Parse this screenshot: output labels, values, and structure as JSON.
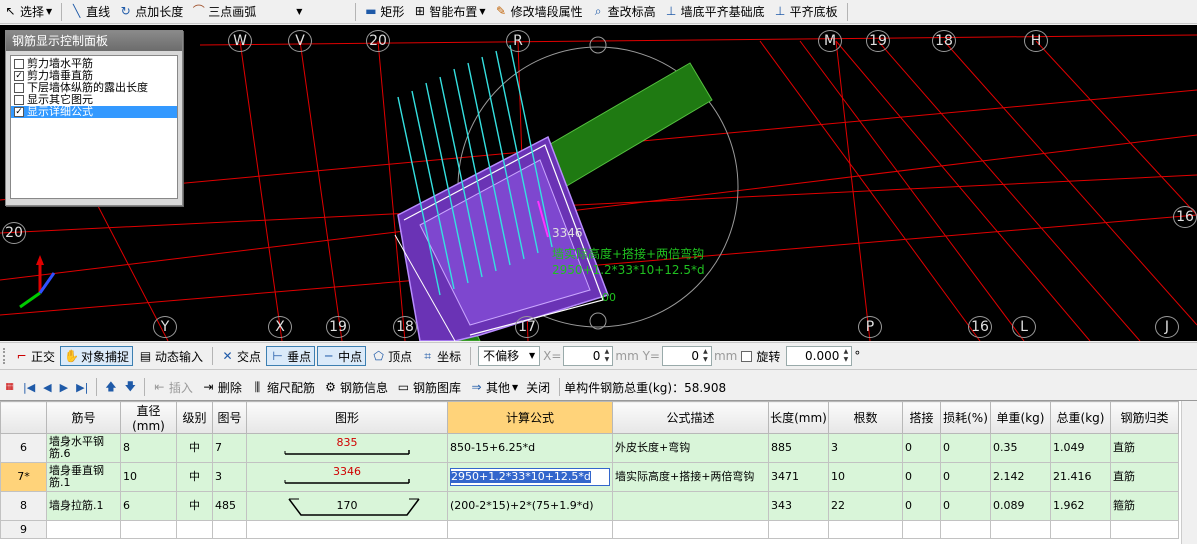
{
  "toolbar_main": [
    {
      "id": "select",
      "label": "选择",
      "icon": "cursor-icon",
      "dropdown": true
    },
    {
      "id": "line",
      "label": "直线",
      "icon": "line-icon"
    },
    {
      "id": "point-length",
      "label": "点加长度",
      "icon": "point-length-icon"
    },
    {
      "id": "arc3",
      "label": "三点画弧",
      "icon": "arc-icon",
      "dropdown": true
    },
    {
      "id": "rect",
      "label": "矩形",
      "icon": "rectangle-icon"
    },
    {
      "id": "smart",
      "label": "智能布置",
      "icon": "smart-layout-icon",
      "dropdown": true
    },
    {
      "id": "modify-wall",
      "label": "修改墙段属性",
      "icon": "edit-wall-icon"
    },
    {
      "id": "check-elev",
      "label": "查改标高",
      "icon": "elevation-icon"
    },
    {
      "id": "align-base",
      "label": "墙底平齐基础底",
      "icon": "wall-align-icon"
    },
    {
      "id": "align-bottom",
      "label": "平齐底板",
      "icon": "slab-align-icon"
    }
  ],
  "panel": {
    "title": "钢筋显示控制面板",
    "items": [
      {
        "label": "剪力墙水平筋",
        "checked": false,
        "selected": false
      },
      {
        "label": "剪力墙垂直筋",
        "checked": true,
        "selected": false
      },
      {
        "label": "下层墙体纵筋的露出长度",
        "checked": false,
        "selected": false
      },
      {
        "label": "显示其它图元",
        "checked": false,
        "selected": false
      },
      {
        "label": "显示详细公式",
        "checked": true,
        "selected": true
      }
    ]
  },
  "canvas": {
    "axis_labels": [
      "W",
      "V",
      "20",
      "R",
      "M",
      "19",
      "18",
      "H",
      "20",
      "16",
      "Y",
      "X",
      "19",
      "18",
      "17",
      "P",
      "16",
      "L",
      "J"
    ],
    "annotation_length": "3346",
    "annotation_desc": "墙实际高度+搭接+两倍弯钩",
    "annotation_formula": "2950+1.2*33*10+12.5*d",
    "annotation_extra": "00"
  },
  "toolbar_snap": {
    "ortho": "正交",
    "snap": "对象捕捉",
    "dyn": "动态输入",
    "intersect": "交点",
    "perp": "垂点",
    "mid": "中点",
    "vertex": "顶点",
    "coord": "坐标",
    "offset": "不偏移",
    "x_label": "X=",
    "x_value": "0",
    "y_label": "mm Y=",
    "y_value": "0",
    "unit": "mm",
    "rotate": "旋转",
    "rotate_value": "0.000",
    "degree": "°"
  },
  "toolbar_grid": {
    "insert": "插入",
    "delete": "删除",
    "scale": "缩尺配筋",
    "rebar_info": "钢筋信息",
    "rebar_lib": "钢筋图库",
    "other": "其他",
    "close": "关闭",
    "total_label": "单构件钢筋总重(kg)：58.908"
  },
  "table": {
    "columns": [
      "",
      "筋号",
      "直径(mm)",
      "级别",
      "图号",
      "图形",
      "计算公式",
      "公式描述",
      "长度(mm)",
      "根数",
      "搭接",
      "损耗(%)",
      "单重(kg)",
      "总重(kg)",
      "钢筋归类"
    ],
    "active_column": 6,
    "rows": [
      {
        "idx": "6",
        "name": "墙身水平钢筋.6",
        "dia": "8",
        "grade": "中",
        "fig": "7",
        "shape_val": "835",
        "shape_type": "bar",
        "formula": "850-15+6.25*d",
        "desc": "外皮长度+弯钩",
        "len": "885",
        "count": "3",
        "lap": "0",
        "loss": "0",
        "unit_w": "0.35",
        "total_w": "1.049",
        "cat": "直筋"
      },
      {
        "idx": "7*",
        "name": "墙身垂直钢筋.1",
        "dia": "10",
        "grade": "中",
        "fig": "3",
        "shape_val": "3346",
        "shape_type": "bar",
        "formula": "2950+1.2*33*10+12.5*d",
        "desc": "墙实际高度+搭接+两倍弯钩",
        "len": "3471",
        "count": "10",
        "lap": "0",
        "loss": "0",
        "unit_w": "2.142",
        "total_w": "21.416",
        "cat": "直筋"
      },
      {
        "idx": "8",
        "name": "墙身拉筋.1",
        "dia": "6",
        "grade": "中",
        "fig": "485",
        "shape_val": "170",
        "shape_type": "tie",
        "formula": "(200-2*15)+2*(75+1.9*d)",
        "desc": "",
        "len": "343",
        "count": "22",
        "lap": "0",
        "loss": "0",
        "unit_w": "0.089",
        "total_w": "1.962",
        "cat": "箍筋"
      },
      {
        "idx": "9",
        "name": "",
        "dia": "",
        "grade": "",
        "fig": "",
        "shape_val": "",
        "shape_type": "none",
        "formula": "",
        "desc": "",
        "len": "",
        "count": "",
        "lap": "",
        "loss": "",
        "unit_w": "",
        "total_w": "",
        "cat": ""
      }
    ]
  },
  "colors": {
    "grid_line": "#e00000",
    "axis_circle": "#9a9a9a",
    "rebar": "#35e0e0",
    "wall": "#7a3fc7",
    "beam": "#1f7a12",
    "row_bg": "#d9f5d9",
    "active": "#ffd37a"
  }
}
